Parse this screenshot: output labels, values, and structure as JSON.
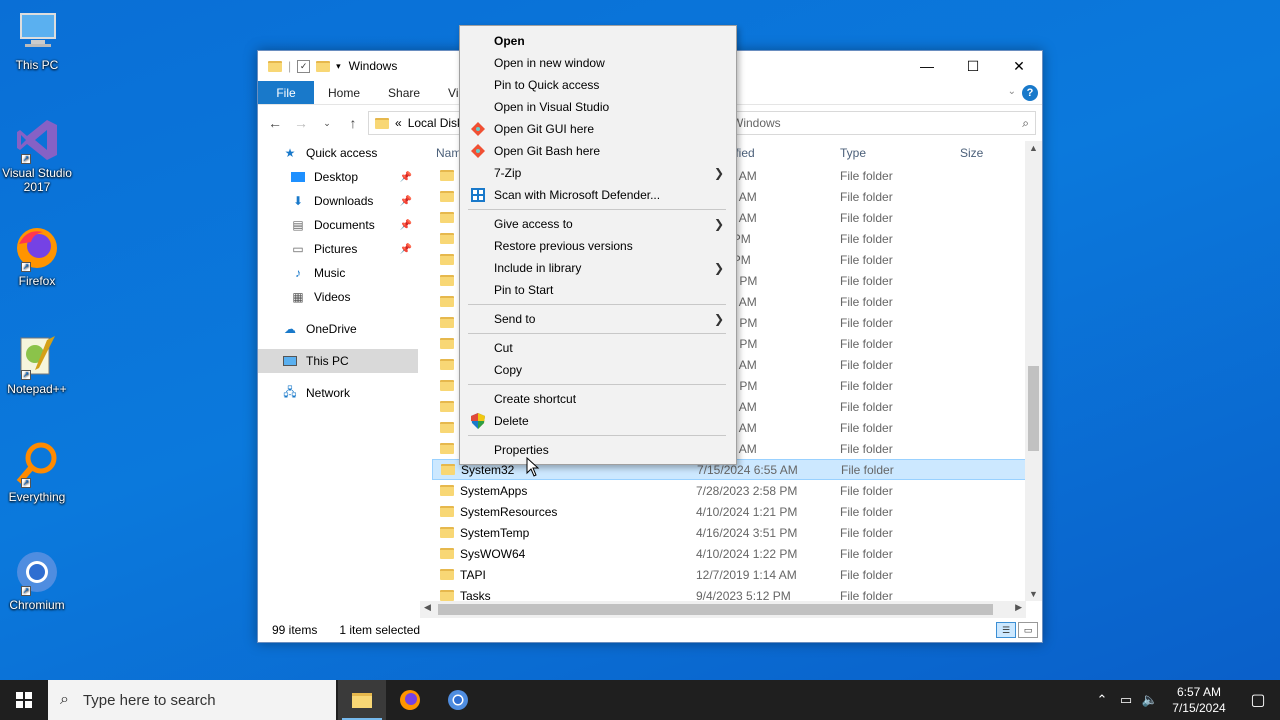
{
  "desktop": {
    "icons": [
      {
        "label": "This PC"
      },
      {
        "label": "Visual Studio 2017"
      },
      {
        "label": "Firefox"
      },
      {
        "label": "Notepad++"
      },
      {
        "label": "Everything"
      },
      {
        "label": "Chromium"
      }
    ]
  },
  "explorer": {
    "title": "Windows",
    "tabs": {
      "file": "File",
      "home": "Home",
      "share": "Share",
      "view": "Vie"
    },
    "address": {
      "prefix": "«",
      "path": "Local Disk",
      "search_hint": "Windows"
    },
    "nav": {
      "quick_access": "Quick access",
      "desktop": "Desktop",
      "downloads": "Downloads",
      "documents": "Documents",
      "pictures": "Pictures",
      "music": "Music",
      "videos": "Videos",
      "onedrive": "OneDrive",
      "this_pc": "This PC",
      "network": "Network"
    },
    "columns": {
      "name": "Nam",
      "date": "dified",
      "type": "Type",
      "size": "Size"
    },
    "rows": [
      {
        "name": "S",
        "date": "19 1:14 AM",
        "type": "File folder"
      },
      {
        "name": "s",
        "date": "19 1:54 AM",
        "type": "File folder"
      },
      {
        "name": "s",
        "date": "19 1:54 AM",
        "type": "File folder"
      },
      {
        "name": "S",
        "date": "3 5:12 PM",
        "type": "File folder"
      },
      {
        "name": "S",
        "date": "3 4:19 PM",
        "type": "File folder"
      },
      {
        "name": "s",
        "date": "24 1:21 PM",
        "type": "File folder"
      },
      {
        "name": "S",
        "date": "19 1:18 AM",
        "type": "File folder"
      },
      {
        "name": "S",
        "date": "24 1:21 PM",
        "type": "File folder"
      },
      {
        "name": "S",
        "date": "24 1:21 PM",
        "type": "File folder"
      },
      {
        "name": "S",
        "date": "19 1:31 AM",
        "type": "File folder"
      },
      {
        "name": "S",
        "date": "24 3:48 PM",
        "type": "File folder"
      },
      {
        "name": "S",
        "date": "19 1:14 AM",
        "type": "File folder"
      },
      {
        "name": "S",
        "date": "19 1:14 AM",
        "type": "File folder"
      },
      {
        "name": "S",
        "date": "19 1:14 AM",
        "type": "File folder"
      },
      {
        "name": "System32",
        "date": "7/15/2024 6:55 AM",
        "type": "File folder"
      },
      {
        "name": "SystemApps",
        "date": "7/28/2023 2:58 PM",
        "type": "File folder"
      },
      {
        "name": "SystemResources",
        "date": "4/10/2024 1:21 PM",
        "type": "File folder"
      },
      {
        "name": "SystemTemp",
        "date": "4/16/2024 3:51 PM",
        "type": "File folder"
      },
      {
        "name": "SysWOW64",
        "date": "4/10/2024 1:22 PM",
        "type": "File folder"
      },
      {
        "name": "TAPI",
        "date": "12/7/2019 1:14 AM",
        "type": "File folder"
      },
      {
        "name": "Tasks",
        "date": "9/4/2023 5:12 PM",
        "type": "File folder"
      }
    ],
    "selected_row": 14,
    "status": {
      "count": "99 items",
      "selected": "1 item selected"
    }
  },
  "context_menu": {
    "items": {
      "open": "Open",
      "open_new_window": "Open in new window",
      "pin_quick_access": "Pin to Quick access",
      "open_vs": "Open in Visual Studio",
      "git_gui": "Open Git GUI here",
      "git_bash": "Open Git Bash here",
      "sevenzip": "7-Zip",
      "defender": "Scan with Microsoft Defender...",
      "give_access": "Give access to",
      "restore": "Restore previous versions",
      "include_library": "Include in library",
      "pin_start": "Pin to Start",
      "send_to": "Send to",
      "cut": "Cut",
      "copy": "Copy",
      "create_shortcut": "Create shortcut",
      "delete": "Delete",
      "properties": "Properties"
    }
  },
  "taskbar": {
    "search_placeholder": "Type here to search",
    "time": "6:57 AM",
    "date": "7/15/2024"
  },
  "colors": {
    "accent": "#1979ca",
    "selection": "#cce8ff",
    "desktop": "#0a6fd6"
  }
}
